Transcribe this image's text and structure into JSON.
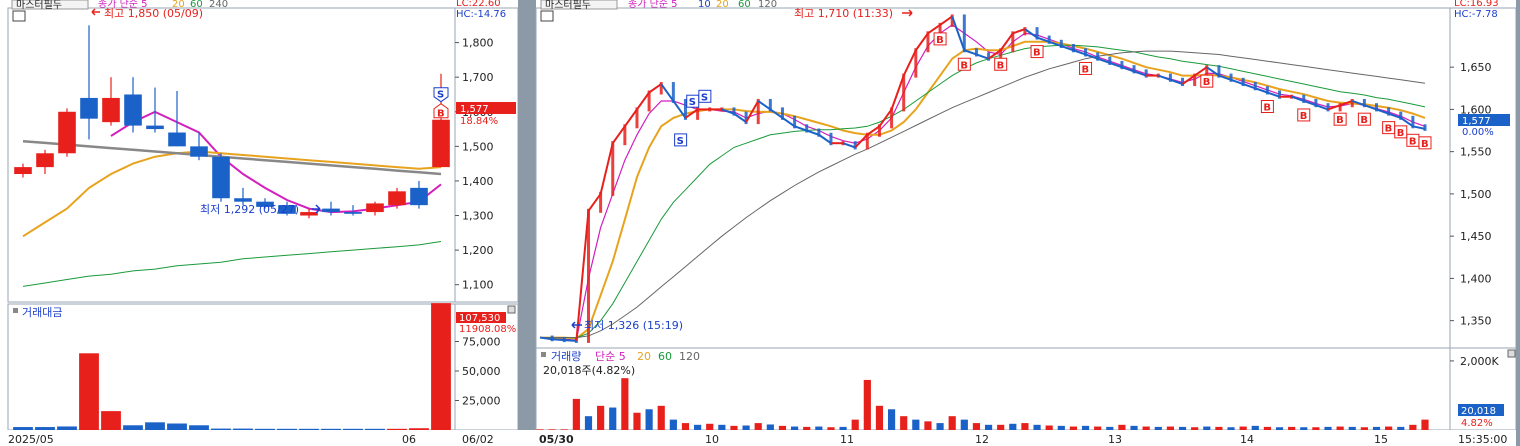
{
  "colors": {
    "up": "#e8201c",
    "down": "#1b62c8",
    "ma5": "#d21fbe",
    "ma20": "#e8a31e",
    "ma60": "#1a9a3a",
    "ma120": "#555555",
    "axis_blue": "#1b3fcc",
    "frame": "#9aa6b4",
    "separator": "#8c9aa8"
  },
  "left_panel": {
    "title": "마스터필두",
    "ma_labels": [
      "종가 단순 5",
      "20",
      "60",
      "240"
    ],
    "lc_text": "LC:22.60",
    "hc_text": "HC:-14.76",
    "high_marker": "최고 1,850 (05/09)",
    "low_marker": "최저 1,292 (05/27)",
    "price_badge": "1,577",
    "change_pct": "18.84%",
    "volume_title": "거래대금",
    "volume_badge": "107,530",
    "volume_sub": "11908.08%",
    "x_labels": [
      "2025/05",
      "06",
      "06/02"
    ],
    "y_ticks": [
      "1,800",
      "1,700",
      "1,600",
      "1,500",
      "1,400",
      "1,300",
      "1,200",
      "1,100"
    ],
    "vol_ticks": [
      "75,000",
      "50,000",
      "25,000"
    ],
    "signals": [
      "S",
      "B"
    ]
  },
  "right_panel": {
    "title": "마스터필두",
    "ma_labels": [
      "종가 단순 5",
      "10",
      "20",
      "60",
      "120"
    ],
    "lc_text": "LC:16.93",
    "hc_text": "HC:-7.78",
    "high_marker": "최고 1,710 (11:33)",
    "low_marker": "최저 1,326 (15:19)",
    "price_badge": "1,577",
    "change_pct": "0.00%",
    "volume_title": "거래량",
    "volume_ma_labels": [
      "단순 5",
      "20",
      "60",
      "120"
    ],
    "volume_info": "20,018주(4.82%)",
    "volume_badge": "20,018",
    "volume_sub": "4.82%",
    "x_labels": [
      "05/30",
      "10",
      "11",
      "12",
      "13",
      "14",
      "15",
      "15:35:00"
    ],
    "y_ticks": [
      "1,650",
      "1,600",
      "1,550",
      "1,500",
      "1,450",
      "1,400",
      "1,350"
    ],
    "vol_ticks": [
      "2,000K"
    ],
    "signals": {
      "S": [
        [
          1,
          "top"
        ],
        [
          2,
          "top"
        ],
        [
          3,
          "top"
        ],
        [
          4,
          "top"
        ]
      ],
      "B": 14
    }
  },
  "chart_data": [
    {
      "type": "candlestick",
      "title": "마스터필두",
      "ylim": [
        1050,
        1900
      ],
      "x": [
        "2025/05",
        "06"
      ],
      "series": [
        {
          "name": "OHLC",
          "values": [
            [
              1420,
              1450,
              1410,
              1440
            ],
            [
              1440,
              1490,
              1420,
              1480
            ],
            [
              1480,
              1610,
              1470,
              1600
            ],
            [
              1640,
              1850,
              1520,
              1580
            ],
            [
              1570,
              1700,
              1560,
              1640
            ],
            [
              1650,
              1700,
              1540,
              1560
            ],
            [
              1560,
              1670,
              1540,
              1550
            ],
            [
              1540,
              1660,
              1510,
              1500
            ],
            [
              1500,
              1540,
              1460,
              1470
            ],
            [
              1470,
              1480,
              1340,
              1350
            ],
            [
              1350,
              1380,
              1330,
              1340
            ],
            [
              1340,
              1350,
              1320,
              1325
            ],
            [
              1330,
              1340,
              1300,
              1305
            ],
            [
              1300,
              1320,
              1292,
              1310
            ],
            [
              1320,
              1340,
              1300,
              1310
            ],
            [
              1310,
              1330,
              1300,
              1305
            ],
            [
              1310,
              1340,
              1300,
              1335
            ],
            [
              1330,
              1380,
              1320,
              1370
            ],
            [
              1380,
              1400,
              1320,
              1330
            ],
            [
              1440,
              1710,
              1440,
              1577
            ]
          ]
        },
        {
          "name": "5",
          "values": [
            null,
            null,
            null,
            null,
            1530,
            1570,
            1600,
            1570,
            1540,
            1470,
            1420,
            1380,
            1345,
            1320,
            1310,
            1312,
            1320,
            1330,
            1340,
            1390
          ]
        },
        {
          "name": "20",
          "values": [
            1240,
            1280,
            1320,
            1380,
            1420,
            1450,
            1470,
            1480,
            1485,
            1480,
            1475,
            1470,
            1465,
            1460,
            1455,
            1450,
            1445,
            1440,
            1435,
            1440
          ]
        },
        {
          "name": "60",
          "values": [
            1095,
            1105,
            1115,
            1125,
            1130,
            1140,
            1145,
            1155,
            1160,
            1165,
            1175,
            1180,
            1185,
            1190,
            1195,
            1200,
            1205,
            1210,
            1215,
            1225
          ]
        },
        {
          "name": "240",
          "values": [
            1515,
            1510,
            1505,
            1500,
            1495,
            1490,
            1485,
            1480,
            1475,
            1470,
            1465,
            1460,
            1455,
            1450,
            1445,
            1440,
            1435,
            1430,
            1425,
            1420
          ]
        }
      ]
    },
    {
      "type": "bar",
      "title": "거래대금",
      "ylim": [
        0,
        100000
      ],
      "values": [
        2500,
        2500,
        3000,
        65000,
        16000,
        4000,
        6500,
        5500,
        4000,
        1200,
        1200,
        1000,
        1000,
        1000,
        1000,
        1000,
        1000,
        1000,
        1500,
        107530
      ],
      "colors": [
        "down",
        "down",
        "down",
        "up",
        "up",
        "down",
        "down",
        "down",
        "down",
        "down",
        "down",
        "down",
        "down",
        "down",
        "down",
        "down",
        "down",
        "up",
        "up",
        "up"
      ]
    },
    {
      "type": "line",
      "title": "마스터필두",
      "ylim": [
        1320,
        1720
      ],
      "x": [
        "05/30",
        "10",
        "11",
        "12",
        "13",
        "14",
        "15"
      ],
      "series": [
        {
          "name": "price",
          "values": [
            1330,
            1328,
            1327,
            1326,
            1480,
            1500,
            1560,
            1580,
            1600,
            1620,
            1630,
            1610,
            1590,
            1600,
            1600,
            1600,
            1595,
            1585,
            1610,
            1600,
            1590,
            1580,
            1575,
            1570,
            1560,
            1560,
            1555,
            1570,
            1580,
            1600,
            1640,
            1670,
            1690,
            1700,
            1710,
            1670,
            1665,
            1660,
            1670,
            1690,
            1695,
            1685,
            1680,
            1675,
            1670,
            1665,
            1660,
            1655,
            1650,
            1645,
            1640,
            1640,
            1635,
            1630,
            1640,
            1650,
            1640,
            1635,
            1630,
            1625,
            1620,
            1615,
            1615,
            1610,
            1605,
            1600,
            1605,
            1610,
            1605,
            1600,
            1595,
            1590,
            1580,
            1577
          ]
        },
        {
          "name": "5",
          "values": [
            1330,
            1330,
            1328,
            1327,
            1400,
            1460,
            1500,
            1540,
            1570,
            1595,
            1610,
            1610,
            1605,
            1600,
            1600,
            1598,
            1597,
            1590,
            1595,
            1598,
            1595,
            1588,
            1580,
            1575,
            1568,
            1563,
            1560,
            1565,
            1575,
            1590,
            1620,
            1650,
            1675,
            1690,
            1700,
            1690,
            1680,
            1668,
            1665,
            1680,
            1690,
            1688,
            1683,
            1678,
            1672,
            1668,
            1662,
            1657,
            1652,
            1647,
            1642,
            1640,
            1636,
            1632,
            1636,
            1643,
            1642,
            1638,
            1633,
            1628,
            1623,
            1618,
            1616,
            1612,
            1607,
            1603,
            1604,
            1607,
            1605,
            1601,
            1597,
            1592,
            1585,
            1580
          ]
        },
        {
          "name": "20",
          "values": [
            1330,
            1330,
            1330,
            1329,
            1340,
            1380,
            1420,
            1470,
            1520,
            1555,
            1580,
            1590,
            1595,
            1598,
            1600,
            1600,
            1600,
            1598,
            1597,
            1597,
            1595,
            1592,
            1588,
            1584,
            1580,
            1575,
            1572,
            1570,
            1570,
            1575,
            1585,
            1600,
            1620,
            1640,
            1660,
            1670,
            1672,
            1670,
            1670,
            1675,
            1680,
            1680,
            1680,
            1678,
            1675,
            1672,
            1668,
            1664,
            1660,
            1655,
            1650,
            1647,
            1644,
            1640,
            1640,
            1641,
            1640,
            1638,
            1635,
            1632,
            1628,
            1624,
            1621,
            1618,
            1614,
            1610,
            1608,
            1607,
            1606,
            1604,
            1602,
            1599,
            1595,
            1590
          ]
        },
        {
          "name": "60",
          "values": [
            1330,
            1330,
            1330,
            1330,
            1335,
            1350,
            1370,
            1395,
            1420,
            1445,
            1470,
            1490,
            1505,
            1520,
            1535,
            1545,
            1555,
            1560,
            1565,
            1570,
            1572,
            1574,
            1575,
            1576,
            1576,
            1577,
            1578,
            1580,
            1585,
            1592,
            1600,
            1610,
            1620,
            1630,
            1640,
            1648,
            1655,
            1660,
            1664,
            1668,
            1672,
            1674,
            1675,
            1676,
            1676,
            1675,
            1674,
            1672,
            1670,
            1668,
            1665,
            1662,
            1660,
            1657,
            1655,
            1653,
            1651,
            1648,
            1645,
            1642,
            1639,
            1636,
            1633,
            1630,
            1627,
            1624,
            1621,
            1619,
            1617,
            1614,
            1612,
            1609,
            1606,
            1603
          ]
        },
        {
          "name": "120",
          "values": [
            1330,
            1330,
            1330,
            1330,
            1332,
            1338,
            1346,
            1356,
            1366,
            1378,
            1390,
            1402,
            1414,
            1426,
            1438,
            1450,
            1461,
            1472,
            1482,
            1492,
            1501,
            1510,
            1518,
            1526,
            1533,
            1540,
            1547,
            1553,
            1560,
            1567,
            1574,
            1581,
            1588,
            1595,
            1602,
            1608,
            1614,
            1620,
            1626,
            1632,
            1638,
            1643,
            1648,
            1652,
            1656,
            1660,
            1663,
            1665,
            1667,
            1668,
            1669,
            1669,
            1669,
            1668,
            1667,
            1666,
            1665,
            1663,
            1661,
            1659,
            1657,
            1655,
            1653,
            1651,
            1649,
            1647,
            1645,
            1643,
            1641,
            1639,
            1637,
            1635,
            1633,
            1631
          ]
        }
      ]
    },
    {
      "type": "bar",
      "title": "거래량",
      "ylim": [
        0,
        2200000
      ],
      "values": [
        20000,
        20000,
        20000,
        900000,
        400000,
        700000,
        650000,
        1500000,
        500000,
        600000,
        700000,
        300000,
        200000,
        150000,
        180000,
        150000,
        120000,
        130000,
        200000,
        160000,
        120000,
        100000,
        90000,
        100000,
        80000,
        90000,
        300000,
        1450000,
        700000,
        600000,
        400000,
        300000,
        250000,
        200000,
        400000,
        300000,
        200000,
        150000,
        150000,
        180000,
        200000,
        150000,
        130000,
        120000,
        100000,
        120000,
        100000,
        90000,
        150000,
        120000,
        100000,
        90000,
        100000,
        90000,
        80000,
        100000,
        90000,
        80000,
        100000,
        120000,
        90000,
        80000,
        90000,
        80000,
        80000,
        90000,
        100000,
        90000,
        80000,
        90000,
        100000,
        90000,
        150000,
        300000
      ],
      "colors": [
        "up",
        "up",
        "up",
        "up",
        "down",
        "up",
        "down",
        "up",
        "up",
        "down",
        "up",
        "down",
        "up",
        "down",
        "up",
        "down",
        "up",
        "down",
        "up",
        "down",
        "up",
        "down",
        "up",
        "down",
        "up",
        "down",
        "up",
        "up",
        "up",
        "down",
        "up",
        "down",
        "up",
        "down",
        "up",
        "down",
        "up",
        "down",
        "up",
        "down",
        "up",
        "down",
        "up",
        "down",
        "up",
        "down",
        "up",
        "down",
        "up",
        "down",
        "up",
        "down",
        "up",
        "down",
        "up",
        "down",
        "up",
        "down",
        "up",
        "down",
        "up",
        "down",
        "up",
        "down",
        "up",
        "down",
        "up",
        "down",
        "up",
        "down",
        "up",
        "down",
        "up",
        "up"
      ]
    }
  ]
}
